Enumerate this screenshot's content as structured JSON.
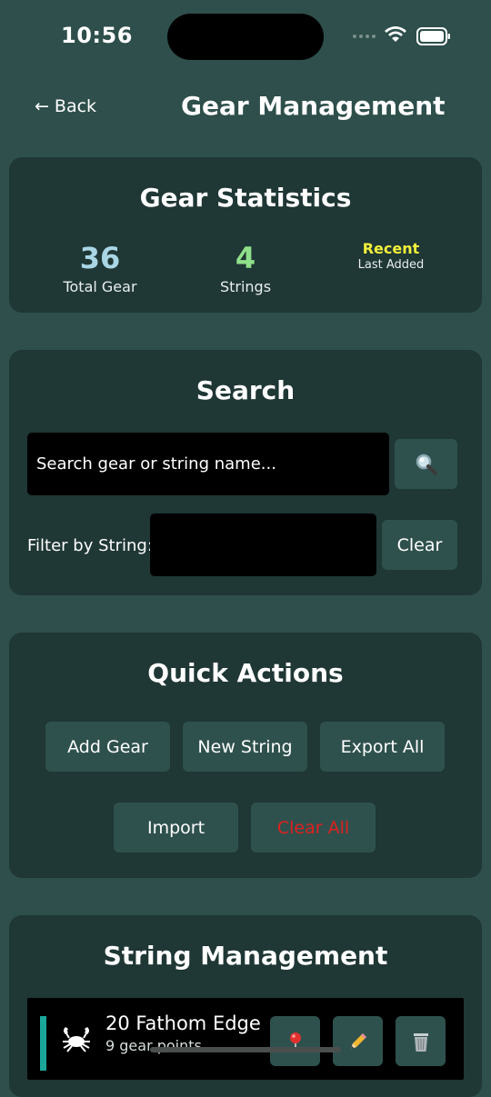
{
  "status": {
    "time": "10:56"
  },
  "header": {
    "back_arrow": "←",
    "back_label": "Back",
    "title": "Gear Management"
  },
  "stats": {
    "title": "Gear Statistics",
    "total_gear_value": "36",
    "total_gear_label": "Total Gear",
    "strings_value": "4",
    "strings_label": "Strings",
    "recent_value": "Recent",
    "recent_label": "Last Added",
    "colors": {
      "total_gear": "#a9d6e5",
      "strings": "#8fe08a",
      "recent": "#f2f03a"
    }
  },
  "search": {
    "title": "Search",
    "placeholder": "Search gear or string name...",
    "value": "",
    "search_icon": "magnifier-icon",
    "filter_label": "Filter by String:",
    "filter_value": "",
    "clear_label": "Clear"
  },
  "quick_actions": {
    "title": "Quick Actions",
    "add_gear": "Add Gear",
    "new_string": "New String",
    "export_all": "Export All",
    "import": "Import",
    "clear_all": "Clear All",
    "danger_color": "#e01f1f"
  },
  "string_management": {
    "title": "String Management",
    "items": [
      {
        "name": "20 Fathom Edge",
        "subtitle": "9 gear points",
        "icon": "crab-icon",
        "accent_color": "#1aa79a",
        "actions": [
          "pin-icon",
          "pencil-icon",
          "trash-icon"
        ]
      }
    ]
  }
}
